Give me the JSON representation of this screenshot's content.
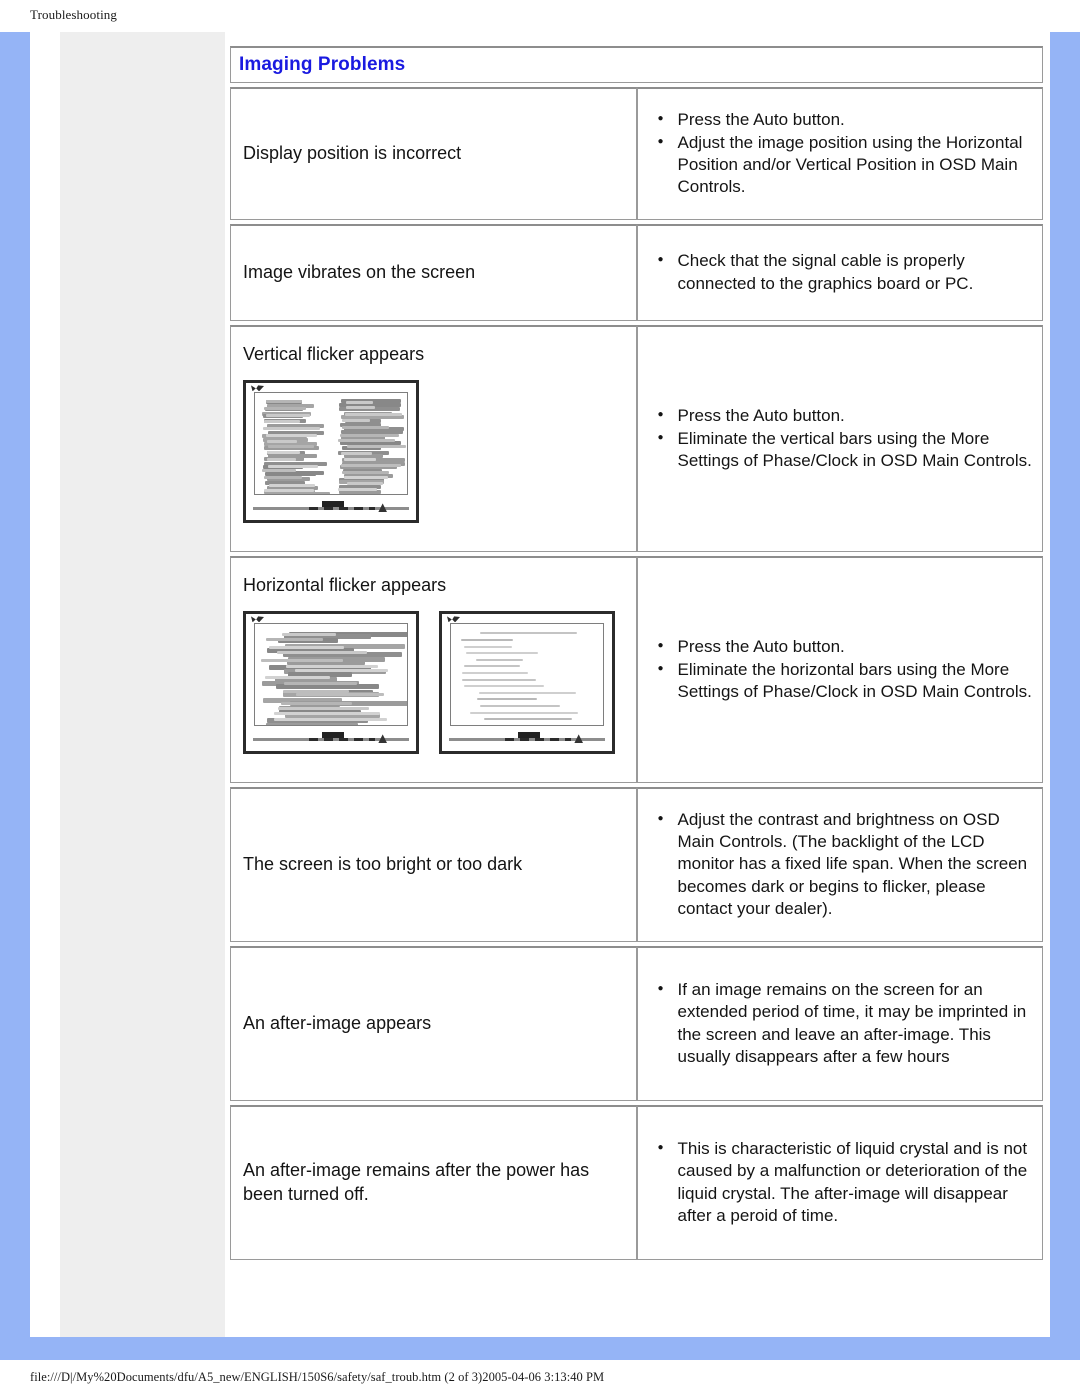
{
  "document": {
    "header": "Troubleshooting",
    "footer": "file:///D|/My%20Documents/dfu/A5_new/ENGLISH/150S6/safety/saf_troub.htm (2 of 3)2005-04-06 3:13:40 PM"
  },
  "colors": {
    "page_border_blue": "#95b4f6",
    "sidebar_gray": "#eeeeee",
    "heading_blue": "#1a1ae0",
    "table_border": "#9a9a9a"
  },
  "section": {
    "heading": "Imaging Problems"
  },
  "rows": [
    {
      "symptom": "Display position is incorrect",
      "solutions": [
        "Press the Auto button.",
        "Adjust the image position using the Horizontal Position and/or Vertical Position in OSD Main Controls."
      ],
      "images": []
    },
    {
      "symptom": "Image vibrates on the screen",
      "solutions": [
        "Check that the signal cable is properly connected to the graphics board or PC."
      ],
      "images": []
    },
    {
      "symptom": "Vertical flicker appears",
      "solutions": [
        "Press the Auto button.",
        "Eliminate the vertical bars using the More Settings of Phase/Clock in OSD Main Controls."
      ],
      "images": [
        "monitor-vertical-flicker"
      ]
    },
    {
      "symptom": "Horizontal flicker appears",
      "solutions": [
        "Press the Auto button.",
        "Eliminate the horizontal bars using the More Settings of Phase/Clock in OSD Main Controls."
      ],
      "images": [
        "monitor-horizontal-flicker",
        "monitor-horizontal-corrected"
      ]
    },
    {
      "symptom": "The screen is too bright or too dark",
      "solutions": [
        "Adjust the contrast and brightness on OSD Main Controls. (The backlight of the LCD monitor has a fixed life span. When the screen becomes dark or begins to flicker, please contact your dealer)."
      ],
      "images": []
    },
    {
      "symptom": "An after-image appears",
      "solutions": [
        "If an image remains on the screen for an extended period of time, it may be imprinted in the screen and leave an after-image. This usually disappears after a few hours"
      ],
      "images": []
    },
    {
      "symptom": "An after-image remains after the power has been turned off.",
      "solutions": [
        "This is characteristic of liquid crystal and is not caused by a malfunction or deterioration of the liquid crystal. The after-image will disappear after a peroid of time."
      ],
      "images": []
    }
  ]
}
